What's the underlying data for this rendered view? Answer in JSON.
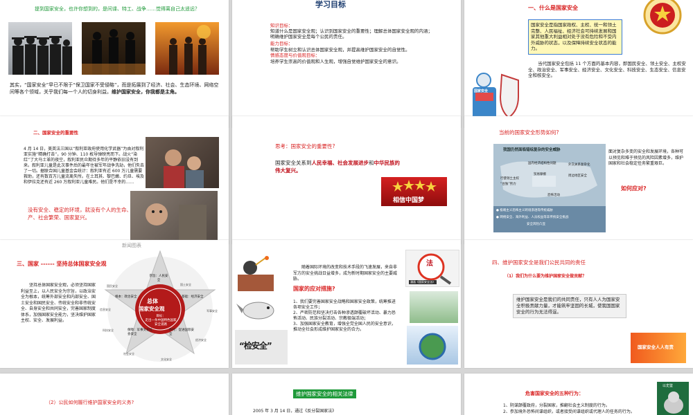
{
  "s1": {
    "heading": "提到国家安全，也许你想到的，是间谍、特工、战争……觉得离自己太遥远？",
    "body": "其实，“国家安全”早已不限于“保卫国家不受侵略”，而是拓展到了经济、社会、生态环境、网络空间等各个领域，关乎我们每一个人的切身利益。",
    "body_bold": "维护国家安全，你我都是主角。"
  },
  "s2": {
    "title": "学习目标",
    "k_label": "知识目标：",
    "k_text1": "知道什么是国家安全观；认识到国家安全的重要性；理解总体国家安全观的内涵；",
    "k_text2": "明确维护国家安全是每个公民的责任。",
    "a_label": "能力目标：",
    "a_text": "帮助学生树立和认识总体国家安全观，并提高维护国家安全的自觉性。",
    "e_label": "情感态度与价值观目标：",
    "e_text": "培养学生崇高的价值观和人生观，增强自觉维护国家安全的意识。"
  },
  "s3": {
    "title": "一、什么是国家安全",
    "box": "国家安全是指国家政权、主权、统一和领土完整、人民福祉、经济社会可持续发展和国家其他重大利益相对处于没有危险和不受内外威胁的状态，以及保障持续安全状态的能力。",
    "body": "当代国家安全包括 11 个方面的基本内容，即国民安全、领土安全、主权安全、政治安全、军事安全、经济安全、文化安全、科技安全、生态安全、信息安全和核安全。",
    "sign": "国家安全"
  },
  "s4": {
    "title": "二、国家安全的重要性",
    "body": "4 月 14 日，美英法三国以“叙利亚政府使用化学武器”为由对叙利亚实施“精确打击”，90 分钟、110 枚导弹映亮而下。战火“染红”了大马士革的夜空，叙利亚民众期待多年的平静依旧没有到来。叙利亚儿童是此次事件后的最年住被军年战争洗劫，他们失去了一切。据联合国儿童基金会统计：叙利亚有近 600 万儿童需要救助，还有数百万儿童流离失所。在土耳其、黎巴嫩、约旦、埃及和伊拉克还有近 260 万叙利亚儿童难民。他们是不幸的……",
    "red": "没有安全、稳定的环境，就没有个人的生命、财产、社会繁荣、国家复兴。"
  },
  "s5": {
    "question": "思考：国家安全的重要性?",
    "text_a": "国家安全关系到",
    "text_b": "人民幸福、社会发展进步",
    "text_c": "和",
    "text_d": "中华民族的伟大复兴。",
    "banner": "相信中国梦"
  },
  "s6": {
    "title": "当前的国家安全形势如何?",
    "map_title": "我国仍然面临错综复杂的安全威胁",
    "map_labels": [
      "国内经济结构性问题",
      "外交关系复杂化",
      "行使领土主权",
      "“台独”势力",
      "贸易摩擦",
      "周边地区安全",
      "恐怖活动"
    ],
    "map_bottom1": "● 极端主义恐怖主义跨境渗透等传统威胁",
    "map_bottom2": "● 网络安全、海外利益、人员权益等非传统安全挑战",
    "map_bottom3": "安全风险凸显",
    "right_text": "面对复杂多变的安全和发展环境，各种可以预见和难于预见的风险因素增多，维护国家和社会稳定任务繁重艰巨。",
    "question": "如何应对?"
  },
  "s7": {
    "title": "三、国家 ------ 坚持总体国家安全观",
    "body": "坚持总体国家安全观，必须坚持国家利益至上，以人民安全为宗旨，以政治安全为根本，统筹外部安全和内部安全、国土安全和国民安全、传统安全和非传统安全、自身安全和共同安全，完善国家制度体系，加强国家安全能力，坚决维护国家主权、安全、发展利益。",
    "star_center1": "总体",
    "star_center2": "国家安全观",
    "star_goal": "目标：\n走出一条中国特色国家安全道路",
    "star_top": "宗旨：人民安全",
    "star_left": "根本：政治安全",
    "star_right": "基础：经济安全",
    "star_bl": "保障：军事文化社会安全",
    "star_br": "依托：促进国际安全",
    "ring": [
      "国民安全",
      "国土安全",
      "军事安全",
      "经济安全",
      "文化安全",
      "社会安全",
      "科技安全",
      "信息安全",
      "生态安全",
      "资源安全",
      "核安全",
      "政治安全"
    ],
    "watermark": "新闻图表"
  },
  "s8": {
    "intro": "随着国际环境的改变和技术手段的飞速发展，来自非军方的安全挑战日益增多，成为新时期国家安全的主要威胁。",
    "heading": "国家的应对措施?",
    "points": [
      "1、我们要完善国家安全战略和国家安全政策，统筹推进各项安全工作；",
      "2、严密防范和坚决打击各种渗透颠覆破坏活动、暴力恐怖活动、民族分裂活动、宗教极端活动；",
      "3、加强国家安全教育，增强全党全国人民的安全意识，推动全社会形成维护国家安全的合力。"
    ],
    "cartoon": "“检安全”",
    "stamp": "法",
    "stamp_caption": "漫画《国家安全法》"
  },
  "s9": {
    "title": "四、维护国家安全是我们公民共同的责任",
    "sub": "（1）我们为什么要为维护国家安全做贡献？",
    "box": "维护国家安全是我们的共同责任，只有人人为国家安全积极贡献力量，才能筑牢坚固的长城，使我国国家安全的行为无法得逞。",
    "banner": "国家安全人人有责"
  },
  "s10": {
    "text": "（2）公民如何履行维护国家安全的义务?"
  },
  "s11": {
    "title": "维护国家安全的相关法律",
    "text": "2005 年 3 月 14 日，通过《反分裂国家法》"
  },
  "s12": {
    "title": "危害国家安全的五种行为：",
    "items": [
      "1、阴谋颠覆政府，分裂国家，推翻社会主义制度的行为。",
      "2、参加境外恐怖间谍组织，或者接受间谍组织或代理人的任务的行为。"
    ],
    "tag": "以史鉴"
  }
}
